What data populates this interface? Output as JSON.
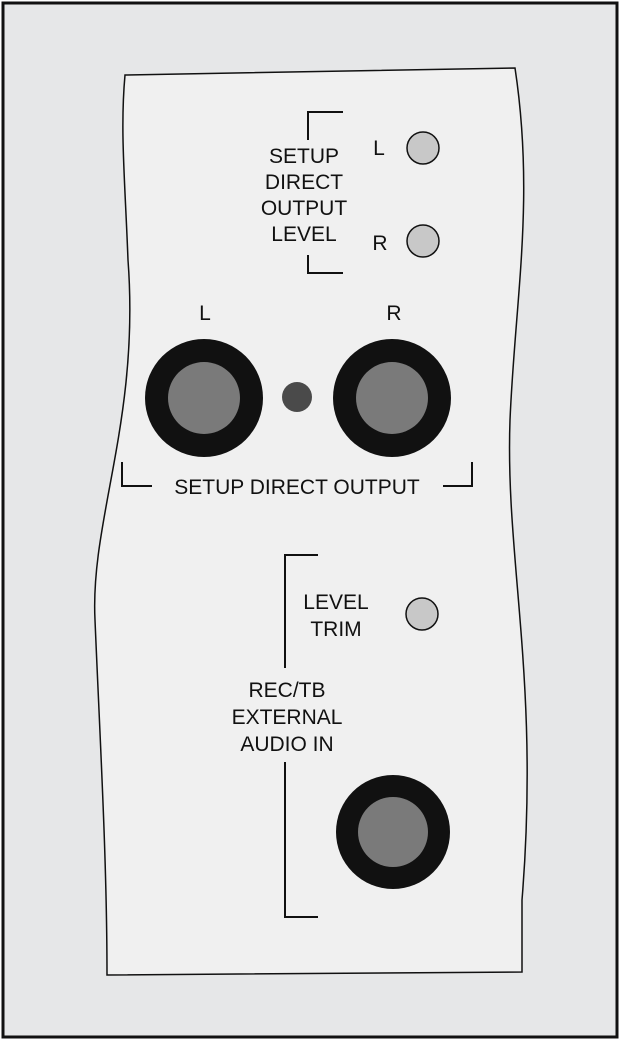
{
  "colors": {
    "outer_background": "#e6e7e8",
    "inner_panel": "#f0f0f0",
    "outline": "#111111",
    "knob_fill": "#c8c8c8",
    "jack_ring": "#111111",
    "jack_center": "#7a7a7a",
    "indicator": "#4a4a4a"
  },
  "direct_output_level": {
    "group_label": [
      "SETUP",
      "DIRECT",
      "OUTPUT",
      "LEVEL"
    ],
    "left_label": "L",
    "right_label": "R"
  },
  "direct_output": {
    "left_label": "L",
    "right_label": "R",
    "group_label": "SETUP DIRECT OUTPUT"
  },
  "external_audio": {
    "trim_label": [
      "LEVEL",
      "TRIM"
    ],
    "group_label": [
      "REC/TB",
      "EXTERNAL",
      "AUDIO IN"
    ]
  },
  "icons": {
    "knob": "trim-pot-icon",
    "jack": "audio-jack-icon",
    "indicator": "led-indicator-icon"
  }
}
